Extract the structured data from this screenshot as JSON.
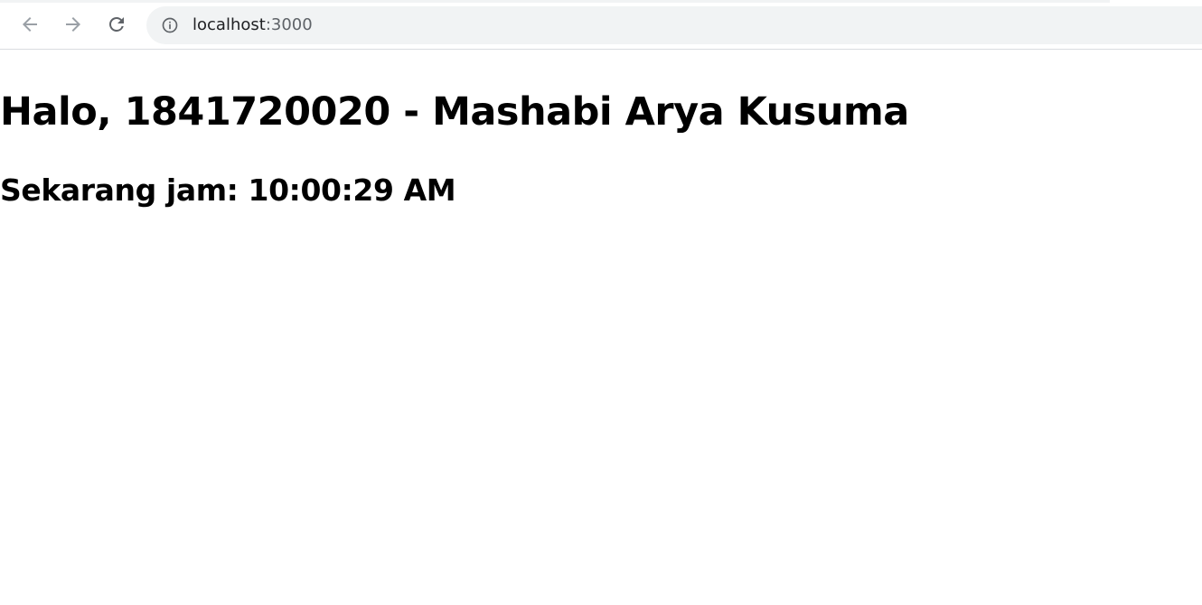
{
  "browser": {
    "url_host": "localhost",
    "url_port": ":3000",
    "icons": {
      "back": "arrow-left-icon",
      "forward": "arrow-right-icon",
      "reload": "reload-icon",
      "site_info": "info-circle-icon"
    },
    "colors": {
      "toolbar_bg": "#ffffff",
      "omnibox_bg": "#f1f3f4",
      "icon_color": "#5f6368",
      "disabled_icon_color": "#9aa0a6"
    }
  },
  "page": {
    "greeting": "Halo, 1841720020 - Mashabi Arya Kusuma",
    "clock_text": "Sekarang jam: 10:00:29 AM"
  }
}
